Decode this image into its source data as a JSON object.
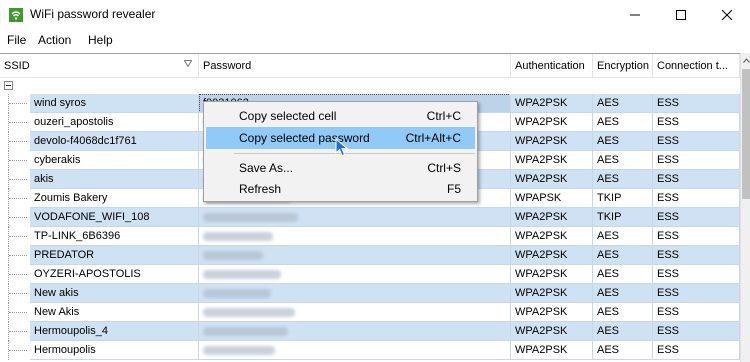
{
  "window": {
    "title": "WiFi password revealer"
  },
  "menu": [
    "File",
    "Action",
    "Help"
  ],
  "columns": [
    "SSID",
    "Password",
    "Authentication",
    "Encryption",
    "Connection t..."
  ],
  "context_menu": {
    "items": [
      {
        "label": "Copy selected cell",
        "shortcut": "Ctrl+C",
        "highlighted": false
      },
      {
        "label": "Copy selected password",
        "shortcut": "Ctrl+Alt+C",
        "highlighted": true
      },
      {
        "label": "Save As...",
        "shortcut": "Ctrl+S",
        "highlighted": false
      },
      {
        "label": "Refresh",
        "shortcut": "F5",
        "highlighted": false
      }
    ]
  },
  "selected_password_partial": "f0031062",
  "rows": [
    {
      "ssid": "wind syros",
      "password": "f0031062",
      "auth": "WPA2PSK",
      "enc": "AES",
      "conn": "ESS"
    },
    {
      "ssid": "ouzeri_apostolis",
      "password": "",
      "auth": "WPA2PSK",
      "enc": "AES",
      "conn": "ESS"
    },
    {
      "ssid": "devolo-f4068dc1f761",
      "password": "",
      "auth": "WPA2PSK",
      "enc": "AES",
      "conn": "ESS"
    },
    {
      "ssid": "cyberakis",
      "password": "",
      "auth": "WPA2PSK",
      "enc": "AES",
      "conn": "ESS"
    },
    {
      "ssid": "akis",
      "password": "",
      "auth": "WPA2PSK",
      "enc": "AES",
      "conn": "ESS"
    },
    {
      "ssid": "Zoumis Bakery",
      "password": "",
      "auth": "WPAPSK",
      "enc": "TKIP",
      "conn": "ESS"
    },
    {
      "ssid": "VODAFONE_WIFI_108",
      "password": "",
      "auth": "WPA2PSK",
      "enc": "TKIP",
      "conn": "ESS"
    },
    {
      "ssid": "TP-LINK_6B6396",
      "password": "",
      "auth": "WPA2PSK",
      "enc": "AES",
      "conn": "ESS"
    },
    {
      "ssid": "PREDATOR",
      "password": "",
      "auth": "WPA2PSK",
      "enc": "AES",
      "conn": "ESS"
    },
    {
      "ssid": "OYZERI-APOSTOLIS",
      "password": "",
      "auth": "WPA2PSK",
      "enc": "AES",
      "conn": "ESS"
    },
    {
      "ssid": "New akis",
      "password": "",
      "auth": "WPA2PSK",
      "enc": "AES",
      "conn": "ESS"
    },
    {
      "ssid": "New Akis",
      "password": "",
      "auth": "WPA2PSK",
      "enc": "AES",
      "conn": "ESS"
    },
    {
      "ssid": "Hermoupolis_4",
      "password": "",
      "auth": "WPA2PSK",
      "enc": "AES",
      "conn": "ESS"
    },
    {
      "ssid": "Hermoupolis",
      "password": "",
      "auth": "WPA2PSK",
      "enc": "AES",
      "conn": "ESS"
    }
  ]
}
